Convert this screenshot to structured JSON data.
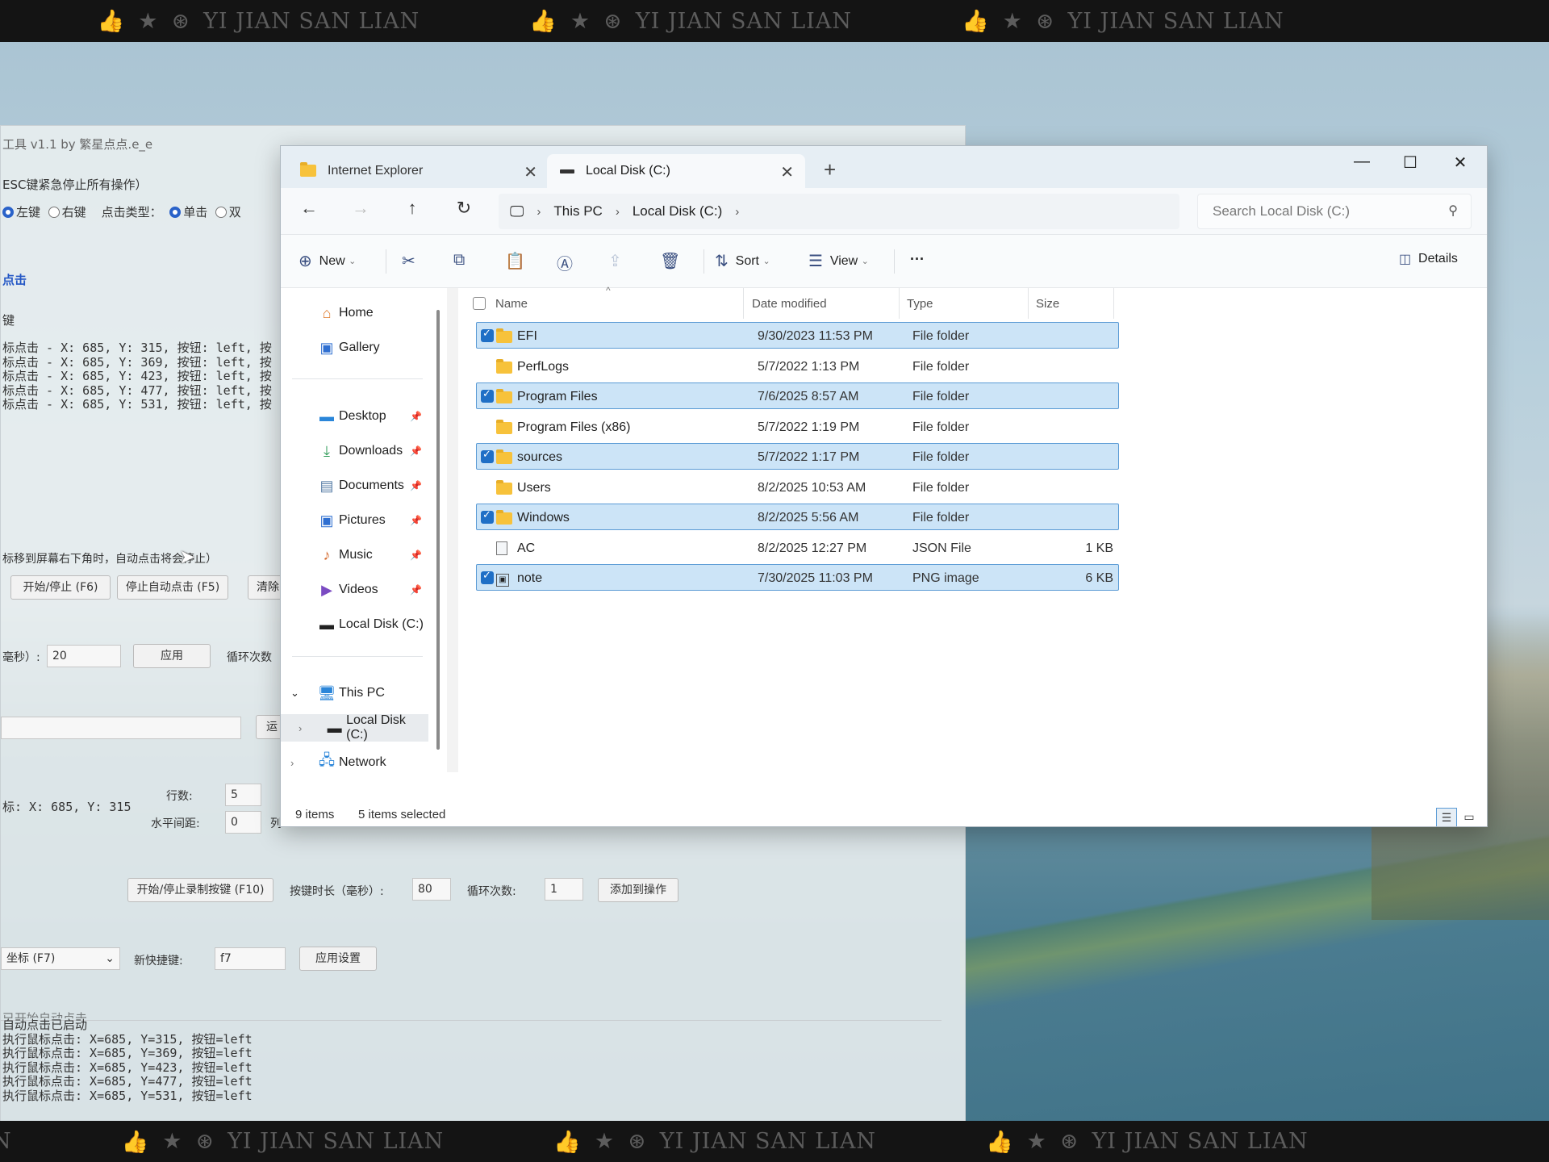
{
  "watermark": {
    "text": "YI JIAN SAN LIAN",
    "icons": [
      "thumbs-up-icon",
      "star-icon",
      "circle-logo-icon"
    ]
  },
  "bg_app": {
    "title": "工具 v1.1 by 繁星点点.e_e",
    "esc_hint": "ESC键紧急停止所有操作）",
    "radio_left": "左键",
    "radio_right": "右键",
    "click_type_label": "点击类型：",
    "radio_single": "单击",
    "radio_double": "双",
    "section_click": "点击",
    "section_key": "键",
    "log_lines": [
      "标点击 - X: 685, Y: 315, 按钮: left, 按",
      "标点击 - X: 685, Y: 369, 按钮: left, 按",
      "标点击 - X: 685, Y: 423, 按钮: left, 按",
      "标点击 - X: 685, Y: 477, 按钮: left, 按",
      "标点击 - X: 685, Y: 531, 按钮: left, 按"
    ],
    "corner_hint": "标移到屏幕右下角时，自动点击将会停止）",
    "btn_start_stop": "开始/停止 (F6)",
    "btn_stop_auto": "停止自动点击 (F5)",
    "btn_clear": "清除",
    "interval_label": "毫秒）:",
    "interval_value": "20",
    "btn_apply": "应用",
    "loop_label": "循环次数",
    "btn_small": "运",
    "coord_text": "标: X: 685, Y: 315",
    "rows_label": "行数:",
    "rows_value": "5",
    "hspace_label": "水平间距:",
    "hspace_value": "0",
    "col_stub": "列",
    "btn_record_key": "开始/停止录制按键 (F10)",
    "key_duration_label": "按键时长（毫秒）:",
    "key_duration_value": "80",
    "loop_count_label": "循环次数:",
    "loop_count_value": "1",
    "btn_add_action": "添加到操作",
    "hotkey_select": "坐标 (F7)",
    "new_hotkey_label": "新快捷键:",
    "new_hotkey_value": "f7",
    "btn_apply_settings": "应用设置",
    "console_lines": [
      "已开始自动点击",
      "自动点击已启动",
      "执行鼠标点击: X=685, Y=315, 按钮=left",
      "执行鼠标点击: X=685, Y=369, 按钮=left",
      "执行鼠标点击: X=685, Y=423, 按钮=left",
      "执行鼠标点击: X=685, Y=477, 按钮=left",
      "执行鼠标点击: X=685, Y=531, 按钮=left"
    ]
  },
  "explorer": {
    "tabs": [
      {
        "label": "Internet Explorer",
        "icon": "folder-icon"
      },
      {
        "label": "Local Disk (C:)",
        "icon": "drive-icon"
      }
    ],
    "breadcrumb": [
      "This PC",
      "Local Disk (C:)"
    ],
    "search_placeholder": "Search Local Disk (C:)",
    "toolbar": {
      "new": "New",
      "sort": "Sort",
      "view": "View",
      "details": "Details",
      "more": "···"
    },
    "nav": {
      "home": "Home",
      "gallery": "Gallery",
      "pinned": [
        "Desktop",
        "Downloads",
        "Documents",
        "Pictures",
        "Music",
        "Videos",
        "Local Disk (C:)"
      ],
      "this_pc": "This PC",
      "local_disk": "Local Disk (C:)",
      "network": "Network"
    },
    "columns": {
      "name": "Name",
      "date": "Date modified",
      "type": "Type",
      "size": "Size"
    },
    "files": [
      {
        "name": "EFI",
        "date": "9/30/2023 11:53 PM",
        "type": "File folder",
        "size": "",
        "selected": true,
        "kind": "folder"
      },
      {
        "name": "PerfLogs",
        "date": "5/7/2022 1:13 PM",
        "type": "File folder",
        "size": "",
        "selected": false,
        "kind": "folder"
      },
      {
        "name": "Program Files",
        "date": "7/6/2025 8:57 AM",
        "type": "File folder",
        "size": "",
        "selected": true,
        "kind": "folder"
      },
      {
        "name": "Program Files (x86)",
        "date": "5/7/2022 1:19 PM",
        "type": "File folder",
        "size": "",
        "selected": false,
        "kind": "folder"
      },
      {
        "name": "sources",
        "date": "5/7/2022 1:17 PM",
        "type": "File folder",
        "size": "",
        "selected": true,
        "kind": "folder"
      },
      {
        "name": "Users",
        "date": "8/2/2025 10:53 AM",
        "type": "File folder",
        "size": "",
        "selected": false,
        "kind": "folder"
      },
      {
        "name": "Windows",
        "date": "8/2/2025 5:56 AM",
        "type": "File folder",
        "size": "",
        "selected": true,
        "kind": "folder"
      },
      {
        "name": "AC",
        "date": "8/2/2025 12:27 PM",
        "type": "JSON File",
        "size": "1 KB",
        "selected": false,
        "kind": "file"
      },
      {
        "name": "note",
        "date": "7/30/2025 11:03 PM",
        "type": "PNG image",
        "size": "6 KB",
        "selected": true,
        "kind": "image"
      }
    ],
    "status": {
      "items": "9 items",
      "selected": "5 items selected"
    }
  }
}
